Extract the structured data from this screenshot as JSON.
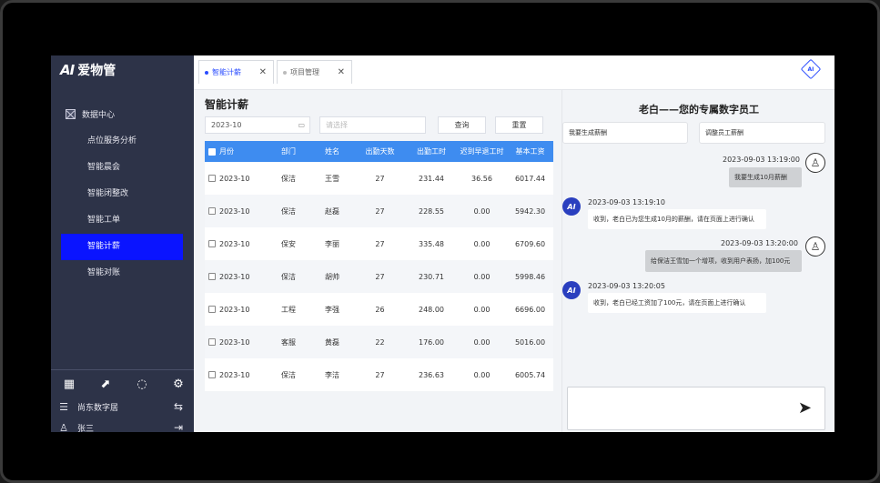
{
  "brand": {
    "mark": "AI",
    "name": "爱物管"
  },
  "sidebar": {
    "group_label": "数据中心",
    "items": [
      {
        "label": "点位服务分析"
      },
      {
        "label": "智能晨会"
      },
      {
        "label": "智能闭整改"
      },
      {
        "label": "智能工单"
      },
      {
        "label": "智能计薪"
      },
      {
        "label": "智能对账"
      }
    ],
    "active_index": 4,
    "tools": [
      "grid-icon",
      "chart-icon",
      "loading-icon",
      "gear-icon"
    ],
    "org_label": "尚东数字居",
    "user_label": "张三"
  },
  "tabs": [
    {
      "label": "智能计薪"
    },
    {
      "label": "项目管理"
    }
  ],
  "main": {
    "title": "智能计薪",
    "month_value": "2023-10",
    "select_placeholder": "请选择",
    "query_label": "查询",
    "reset_label": "重置",
    "columns": [
      "月份",
      "部门",
      "姓名",
      "出勤天数",
      "出勤工时",
      "迟到早退工时",
      "基本工资"
    ],
    "rows": [
      [
        "2023-10",
        "保洁",
        "王雪",
        "27",
        "231.44",
        "36.56",
        "6017.44"
      ],
      [
        "2023-10",
        "保洁",
        "赵磊",
        "27",
        "228.55",
        "0.00",
        "5942.30"
      ],
      [
        "2023-10",
        "保安",
        "李丽",
        "27",
        "335.48",
        "0.00",
        "6709.60"
      ],
      [
        "2023-10",
        "保洁",
        "胡帅",
        "27",
        "230.71",
        "0.00",
        "5998.46"
      ],
      [
        "2023-10",
        "工程",
        "李强",
        "26",
        "248.00",
        "0.00",
        "6696.00"
      ],
      [
        "2023-10",
        "客服",
        "黄磊",
        "22",
        "176.00",
        "0.00",
        "5016.00"
      ],
      [
        "2023-10",
        "保洁",
        "李洁",
        "27",
        "236.63",
        "0.00",
        "6005.74"
      ]
    ]
  },
  "chat": {
    "title": "老白——您的专属数字员工",
    "quick_1": "我要生成薪酬",
    "quick_2": "调整员工薪酬",
    "messages": [
      {
        "role": "user",
        "time": "2023-09-03 13:19:00",
        "text": "我要生成10月薪酬"
      },
      {
        "role": "bot",
        "time": "2023-09-03 13:19:10",
        "text": "收到，老白已为您生成10月的薪酬，请在页面上进行确认"
      },
      {
        "role": "user",
        "time": "2023-09-03 13:20:00",
        "text": "给保洁王雪加一个增项，收到用户表扬，加100元"
      },
      {
        "role": "bot",
        "time": "2023-09-03 13:20:05",
        "text": "收到，老白已经工资加了100元，请在页面上进行确认"
      }
    ]
  }
}
